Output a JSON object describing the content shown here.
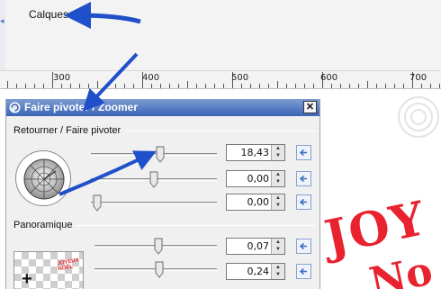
{
  "top_menu": {
    "calques_label": "Calques"
  },
  "ruler": {
    "labels": [
      "300",
      "400",
      "500",
      "600",
      "700"
    ]
  },
  "dialog": {
    "title": "Faire pivoter / Zoomer",
    "close_symbol": "✕",
    "rotate_section": {
      "label": "Retourner / Faire pivoter",
      "rows": [
        {
          "value": "18,43",
          "slider_level": 0.55
        },
        {
          "value": "0,00",
          "slider_level": 0.5
        },
        {
          "value": "0,00",
          "slider_level": 0.05
        }
      ]
    },
    "pan_section": {
      "label": "Panoramique",
      "rows": [
        {
          "value": "0,07",
          "slider_level": 0.52
        },
        {
          "value": "0,24",
          "slider_level": 0.53
        }
      ],
      "preview_text": "JOYEUX NOËL"
    }
  },
  "canvas": {
    "line1": "JOY",
    "line2": "No"
  },
  "icons": {
    "title": "rotate-zoom-icon",
    "close": "close-icon",
    "spin": "spin-arrows-icon",
    "reset": "reset-arrow-icon",
    "knob": "rotation-knob-icon",
    "arrow": "annotation-arrow-icon"
  },
  "colors": {
    "titlebar": "#3a64b6",
    "arrow": "#1f4fc9",
    "canvas_text": "#e8232f"
  }
}
